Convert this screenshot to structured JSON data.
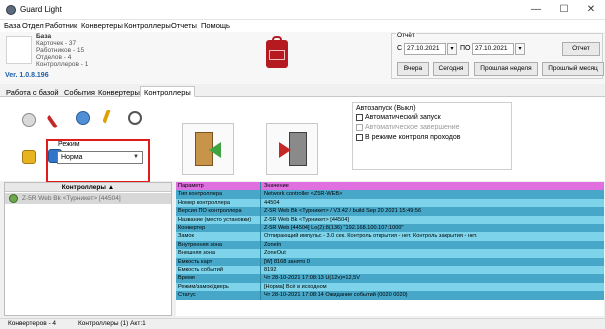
{
  "window": {
    "title": "Guard Light",
    "minimize": "—",
    "maximize": "☐",
    "close": "✕"
  },
  "menu": [
    "База",
    "Отдел",
    "Работник",
    "Конвертеры",
    "Контроллеры",
    "Отчеты",
    "Помощь"
  ],
  "stats": {
    "heading": "База",
    "cards": "Карточек - 37",
    "workers": "Работников - 15",
    "departments": "Отделов - 4",
    "controllers": "Контроллеров - 1"
  },
  "version": "Ver. 1.0.8.196",
  "report": {
    "title": "Отчёт",
    "from_label": "С",
    "from_date": "27.10.2021",
    "to_label": "ПО",
    "to_date": "27.10.2021",
    "report_button": "Отчет",
    "yesterday_button": "Вчера",
    "today_button": "Сегодня",
    "last_week_button": "Прошлая неделя",
    "last_month_button": "Прошлый месяц"
  },
  "tabs": [
    "Работа с базой",
    "События",
    "Конвертеры",
    "Контроллеры"
  ],
  "active_tab_index": 3,
  "mode": {
    "label": "Режим",
    "value": "Норма"
  },
  "autostart": {
    "title": "Автозапуск (Выкл)",
    "auto_start": "Автоматический запуск",
    "auto_finish": "Автоматическое завершение",
    "control_mode": "В режиме контроля проходов"
  },
  "tree": {
    "header": "Контроллеры",
    "sort_indicator": "▲",
    "item": "Z-5R Web Bk <Турникет> [44504]"
  },
  "grid": {
    "header_key": "Параметр",
    "header_value": "Значение",
    "rows": [
      {
        "key": "Тип контроллера",
        "value": "Network controller <Z5R-WEB>"
      },
      {
        "key": "Номер контроллера",
        "value": "44504"
      },
      {
        "key": "Версия ПО контроллера",
        "value": "Z-5R Web Bk <Турникет> / V3.42 / build Sep 20 2021  15:49:56"
      },
      {
        "key": "Название (место установки)",
        "value": "Z-5R Web Bk <Турникет> [44504]"
      },
      {
        "key": "Конвертер",
        "value": "Z-5R Web [44504] Lo(2):8(136) \"192.168.100.107:1000\""
      },
      {
        "key": "Замок",
        "value": "Отпирающий импульс - 3.0 сек. Контроль открытия - нет. Контроль закрытия - нет."
      },
      {
        "key": "Внутренняя зона",
        "value": "ZoneIn"
      },
      {
        "key": "Внешняя зона",
        "value": "ZoneOut"
      },
      {
        "key": "Емкость карт",
        "value": "[W] 8168 занято 0"
      },
      {
        "key": "Емкость событий",
        "value": "8192"
      },
      {
        "key": "Время",
        "value": "Чт 28-10-2021 17:08:13 U(12v)=12,5V"
      },
      {
        "key": "Режим/замок/дверь",
        "value": "[Норма] Всё в исходном"
      },
      {
        "key": "Статус",
        "value": "Чт 28-10-2021 17:08:14 Ожидание событий (0020 0020)"
      }
    ]
  },
  "status": {
    "converters": "Конвертеров - 4",
    "controllers": "Контроллеры (1) Акт:1"
  },
  "colors": {
    "header_row": "#e070e0",
    "row_even": "#47a7c8",
    "row_odd": "#7dd4ea",
    "highlight_border": "#e01b1b"
  }
}
